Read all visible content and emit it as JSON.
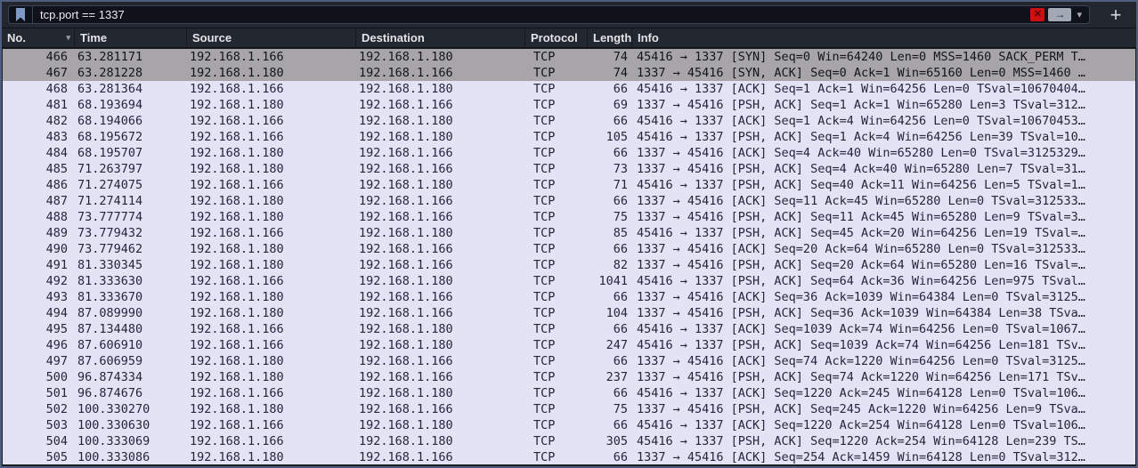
{
  "filter_bar": {
    "filter_text": "tcp.port == 1337",
    "clear_label": "✕",
    "apply_label": "→",
    "dropdown_label": "▾",
    "add_label": "+"
  },
  "colors": {
    "window_border": "#4f5d7e",
    "toolbar_bg": "#22262f",
    "filter_box_bg": "#0f121b",
    "bookmark_icon": "#7d9bc4",
    "clear_button_bg": "#cf1010",
    "apply_button_bg": "#a3a9b4",
    "header_bg": "#23272f",
    "row_tcp_bg": "#e4e3f6",
    "row_tcp_fg": "#23263c",
    "row_syn_bg": "#a7a5a7",
    "row_syn_fg": "#131519"
  },
  "packet_list": {
    "columns": [
      "No.",
      "Time",
      "Source",
      "Destination",
      "Protocol",
      "Length",
      "Info"
    ],
    "sort_indicator": "▾",
    "rows": [
      {
        "no": "466",
        "time": "63.281171",
        "source": "192.168.1.166",
        "destination": "192.168.1.180",
        "protocol": "TCP",
        "length": "74",
        "info": "45416 → 1337 [SYN] Seq=0 Win=64240 Len=0 MSS=1460 SACK_PERM T…",
        "row_style": "syn"
      },
      {
        "no": "467",
        "time": "63.281228",
        "source": "192.168.1.180",
        "destination": "192.168.1.166",
        "protocol": "TCP",
        "length": "74",
        "info": "1337 → 45416 [SYN, ACK] Seq=0 Ack=1 Win=65160 Len=0 MSS=1460 …",
        "row_style": "syn"
      },
      {
        "no": "468",
        "time": "63.281364",
        "source": "192.168.1.166",
        "destination": "192.168.1.180",
        "protocol": "TCP",
        "length": "66",
        "info": "45416 → 1337 [ACK] Seq=1 Ack=1 Win=64256 Len=0 TSval=10670404…",
        "row_style": "tcp"
      },
      {
        "no": "481",
        "time": "68.193694",
        "source": "192.168.1.180",
        "destination": "192.168.1.166",
        "protocol": "TCP",
        "length": "69",
        "info": "1337 → 45416 [PSH, ACK] Seq=1 Ack=1 Win=65280 Len=3 TSval=312…",
        "row_style": "tcp"
      },
      {
        "no": "482",
        "time": "68.194066",
        "source": "192.168.1.166",
        "destination": "192.168.1.180",
        "protocol": "TCP",
        "length": "66",
        "info": "45416 → 1337 [ACK] Seq=1 Ack=4 Win=64256 Len=0 TSval=10670453…",
        "row_style": "tcp"
      },
      {
        "no": "483",
        "time": "68.195672",
        "source": "192.168.1.166",
        "destination": "192.168.1.180",
        "protocol": "TCP",
        "length": "105",
        "info": "45416 → 1337 [PSH, ACK] Seq=1 Ack=4 Win=64256 Len=39 TSval=10…",
        "row_style": "tcp"
      },
      {
        "no": "484",
        "time": "68.195707",
        "source": "192.168.1.180",
        "destination": "192.168.1.166",
        "protocol": "TCP",
        "length": "66",
        "info": "1337 → 45416 [ACK] Seq=4 Ack=40 Win=65280 Len=0 TSval=3125329…",
        "row_style": "tcp"
      },
      {
        "no": "485",
        "time": "71.263797",
        "source": "192.168.1.180",
        "destination": "192.168.1.166",
        "protocol": "TCP",
        "length": "73",
        "info": "1337 → 45416 [PSH, ACK] Seq=4 Ack=40 Win=65280 Len=7 TSval=31…",
        "row_style": "tcp"
      },
      {
        "no": "486",
        "time": "71.274075",
        "source": "192.168.1.166",
        "destination": "192.168.1.180",
        "protocol": "TCP",
        "length": "71",
        "info": "45416 → 1337 [PSH, ACK] Seq=40 Ack=11 Win=64256 Len=5 TSval=1…",
        "row_style": "tcp"
      },
      {
        "no": "487",
        "time": "71.274114",
        "source": "192.168.1.180",
        "destination": "192.168.1.166",
        "protocol": "TCP",
        "length": "66",
        "info": "1337 → 45416 [ACK] Seq=11 Ack=45 Win=65280 Len=0 TSval=312533…",
        "row_style": "tcp"
      },
      {
        "no": "488",
        "time": "73.777774",
        "source": "192.168.1.180",
        "destination": "192.168.1.166",
        "protocol": "TCP",
        "length": "75",
        "info": "1337 → 45416 [PSH, ACK] Seq=11 Ack=45 Win=65280 Len=9 TSval=3…",
        "row_style": "tcp"
      },
      {
        "no": "489",
        "time": "73.779432",
        "source": "192.168.1.166",
        "destination": "192.168.1.180",
        "protocol": "TCP",
        "length": "85",
        "info": "45416 → 1337 [PSH, ACK] Seq=45 Ack=20 Win=64256 Len=19 TSval=…",
        "row_style": "tcp"
      },
      {
        "no": "490",
        "time": "73.779462",
        "source": "192.168.1.180",
        "destination": "192.168.1.166",
        "protocol": "TCP",
        "length": "66",
        "info": "1337 → 45416 [ACK] Seq=20 Ack=64 Win=65280 Len=0 TSval=312533…",
        "row_style": "tcp"
      },
      {
        "no": "491",
        "time": "81.330345",
        "source": "192.168.1.180",
        "destination": "192.168.1.166",
        "protocol": "TCP",
        "length": "82",
        "info": "1337 → 45416 [PSH, ACK] Seq=20 Ack=64 Win=65280 Len=16 TSval=…",
        "row_style": "tcp"
      },
      {
        "no": "492",
        "time": "81.333630",
        "source": "192.168.1.166",
        "destination": "192.168.1.180",
        "protocol": "TCP",
        "length": "1041",
        "info": "45416 → 1337 [PSH, ACK] Seq=64 Ack=36 Win=64256 Len=975 TSval…",
        "row_style": "tcp"
      },
      {
        "no": "493",
        "time": "81.333670",
        "source": "192.168.1.180",
        "destination": "192.168.1.166",
        "protocol": "TCP",
        "length": "66",
        "info": "1337 → 45416 [ACK] Seq=36 Ack=1039 Win=64384 Len=0 TSval=3125…",
        "row_style": "tcp"
      },
      {
        "no": "494",
        "time": "87.089990",
        "source": "192.168.1.180",
        "destination": "192.168.1.166",
        "protocol": "TCP",
        "length": "104",
        "info": "1337 → 45416 [PSH, ACK] Seq=36 Ack=1039 Win=64384 Len=38 TSva…",
        "row_style": "tcp"
      },
      {
        "no": "495",
        "time": "87.134480",
        "source": "192.168.1.166",
        "destination": "192.168.1.180",
        "protocol": "TCP",
        "length": "66",
        "info": "45416 → 1337 [ACK] Seq=1039 Ack=74 Win=64256 Len=0 TSval=1067…",
        "row_style": "tcp"
      },
      {
        "no": "496",
        "time": "87.606910",
        "source": "192.168.1.166",
        "destination": "192.168.1.180",
        "protocol": "TCP",
        "length": "247",
        "info": "45416 → 1337 [PSH, ACK] Seq=1039 Ack=74 Win=64256 Len=181 TSv…",
        "row_style": "tcp"
      },
      {
        "no": "497",
        "time": "87.606959",
        "source": "192.168.1.180",
        "destination": "192.168.1.166",
        "protocol": "TCP",
        "length": "66",
        "info": "1337 → 45416 [ACK] Seq=74 Ack=1220 Win=64256 Len=0 TSval=3125…",
        "row_style": "tcp"
      },
      {
        "no": "500",
        "time": "96.874334",
        "source": "192.168.1.180",
        "destination": "192.168.1.166",
        "protocol": "TCP",
        "length": "237",
        "info": "1337 → 45416 [PSH, ACK] Seq=74 Ack=1220 Win=64256 Len=171 TSv…",
        "row_style": "tcp"
      },
      {
        "no": "501",
        "time": "96.874676",
        "source": "192.168.1.166",
        "destination": "192.168.1.180",
        "protocol": "TCP",
        "length": "66",
        "info": "45416 → 1337 [ACK] Seq=1220 Ack=245 Win=64128 Len=0 TSval=106…",
        "row_style": "tcp"
      },
      {
        "no": "502",
        "time": "100.330270",
        "source": "192.168.1.180",
        "destination": "192.168.1.166",
        "protocol": "TCP",
        "length": "75",
        "info": "1337 → 45416 [PSH, ACK] Seq=245 Ack=1220 Win=64256 Len=9 TSva…",
        "row_style": "tcp"
      },
      {
        "no": "503",
        "time": "100.330630",
        "source": "192.168.1.166",
        "destination": "192.168.1.180",
        "protocol": "TCP",
        "length": "66",
        "info": "45416 → 1337 [ACK] Seq=1220 Ack=254 Win=64128 Len=0 TSval=106…",
        "row_style": "tcp"
      },
      {
        "no": "504",
        "time": "100.333069",
        "source": "192.168.1.166",
        "destination": "192.168.1.180",
        "protocol": "TCP",
        "length": "305",
        "info": "45416 → 1337 [PSH, ACK] Seq=1220 Ack=254 Win=64128 Len=239 TS…",
        "row_style": "tcp"
      },
      {
        "no": "505",
        "time": "100.333086",
        "source": "192.168.1.180",
        "destination": "192.168.1.166",
        "protocol": "TCP",
        "length": "66",
        "info": "1337 → 45416 [ACK] Seq=254 Ack=1459 Win=64128 Len=0 TSval=312…",
        "row_style": "tcp"
      }
    ]
  }
}
